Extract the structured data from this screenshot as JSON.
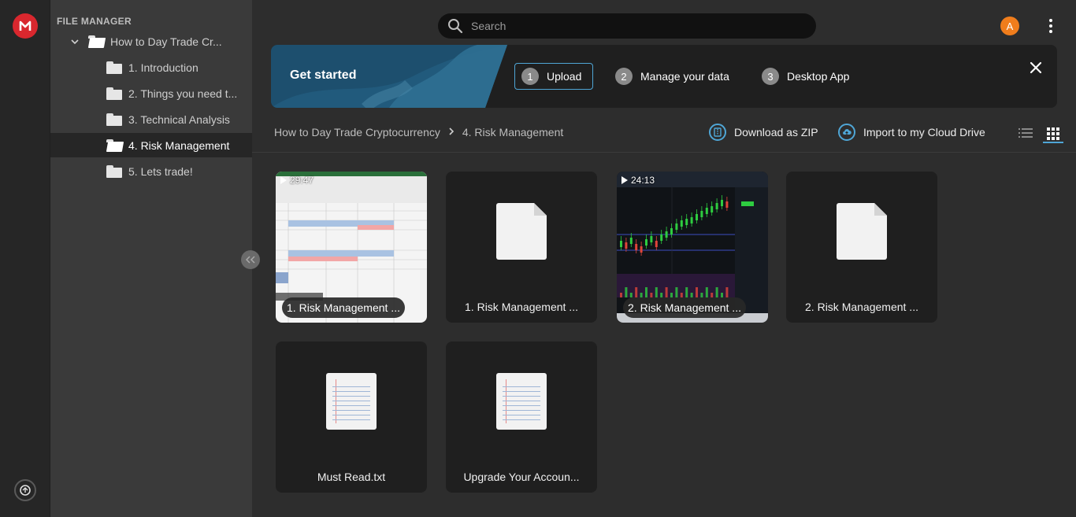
{
  "tree": {
    "title": "FILE MANAGER",
    "root": "How to Day Trade Cr...",
    "items": [
      {
        "label": "1. Introduction"
      },
      {
        "label": "2. Things you need t..."
      },
      {
        "label": "3. Technical Analysis"
      },
      {
        "label": "4. Risk Management"
      },
      {
        "label": "5. Lets trade!"
      }
    ]
  },
  "header": {
    "search_placeholder": "Search",
    "avatar_initial": "A"
  },
  "banner": {
    "title": "Get started",
    "steps": [
      {
        "num": "1",
        "label": "Upload"
      },
      {
        "num": "2",
        "label": "Manage your data"
      },
      {
        "num": "3",
        "label": "Desktop App"
      }
    ]
  },
  "breadcrumb": {
    "parent": "How to Day Trade Cryptocurrency",
    "current": "4. Risk Management"
  },
  "actions": {
    "download": "Download as ZIP",
    "import": "Import to my Cloud Drive"
  },
  "files": [
    {
      "name": "1. Risk Management ...",
      "duration": "29:47",
      "kind": "video-sheet"
    },
    {
      "name": "1. Risk Management ...",
      "kind": "doc"
    },
    {
      "name": "2. Risk Management ...",
      "duration": "24:13",
      "kind": "video-chart"
    },
    {
      "name": "2. Risk Management ...",
      "kind": "doc"
    },
    {
      "name": "Must Read.txt",
      "kind": "txt"
    },
    {
      "name": "Upgrade Your Accoun...",
      "kind": "txt"
    }
  ],
  "colors": {
    "accent": "#4fa6d6",
    "brand": "#d9272e",
    "avatar": "#f07d1c"
  }
}
